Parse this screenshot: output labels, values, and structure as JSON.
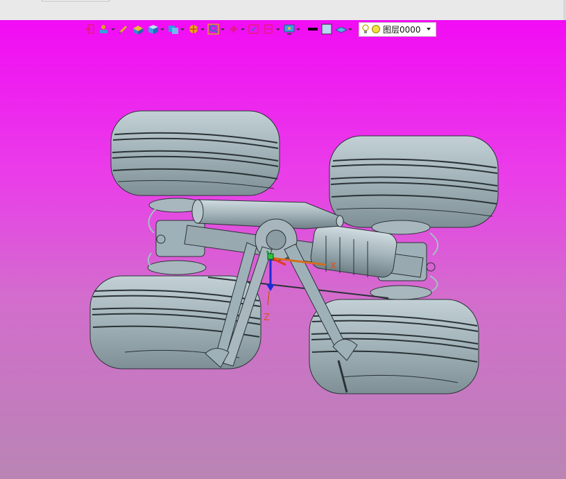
{
  "layer": {
    "label": "图层0000"
  },
  "axes": {
    "x": "X",
    "z": "Z"
  },
  "toolbar_icons": [
    "exit-icon",
    "drawing-tool-icon",
    "sketch-icon",
    "extrude-icon",
    "solid-box-icon",
    "view-cube-icon",
    "render-style-icon",
    "zoom-fit-icon",
    "origin-icon",
    "wcs-icon",
    "section-icon",
    "display-icon",
    "color-black-swatch",
    "color-light-swatch",
    "material-icon"
  ],
  "colors": {
    "viewport_top": "#f20cf4",
    "viewport_bottom": "#b985b4",
    "model_body": "#9fb1b8",
    "model_edge": "#2a3236"
  }
}
